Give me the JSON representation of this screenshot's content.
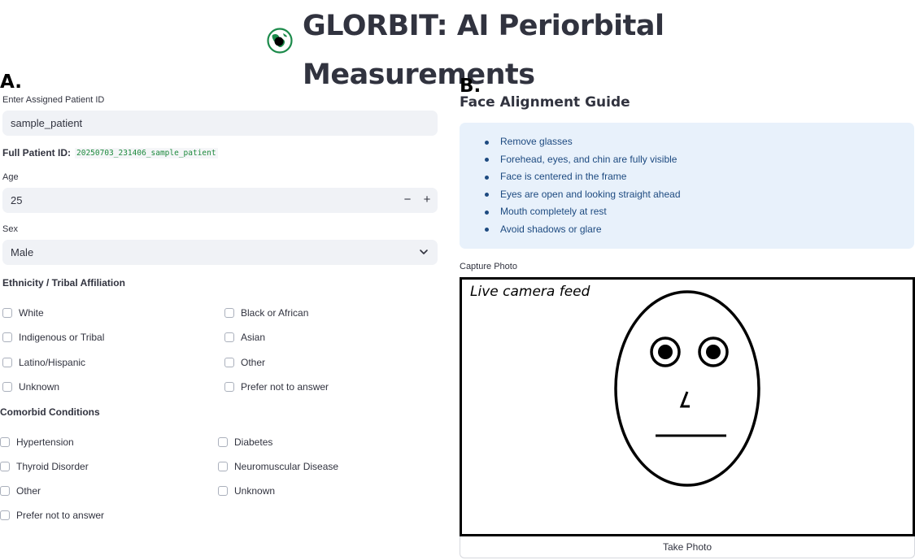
{
  "header": {
    "title_line1": "GLORBIT: AI Periorbital",
    "title_line2": "Measurements",
    "logo_icon": "globe-icon"
  },
  "panel_a": {
    "letter": "A.",
    "patient_id": {
      "label": "Enter Assigned Patient ID",
      "value": "sample_patient"
    },
    "full_id": {
      "label": "Full Patient ID:",
      "value": "20250703_231406_sample_patient"
    },
    "age": {
      "label": "Age",
      "value": "25",
      "minus": "−",
      "plus": "+"
    },
    "sex": {
      "label": "Sex",
      "value": "Male"
    },
    "ethnicity": {
      "title": "Ethnicity / Tribal Affiliation",
      "left": [
        "White",
        "Indigenous or Tribal",
        "Latino/Hispanic",
        "Unknown"
      ],
      "right": [
        "Black or African",
        "Asian",
        "Other",
        "Prefer not to answer"
      ]
    },
    "comorbid": {
      "title": "Comorbid Conditions",
      "left": [
        "Hypertension",
        "Thyroid Disorder",
        "Other",
        "Prefer not to answer"
      ],
      "right": [
        "Diabetes",
        "Neuromuscular Disease",
        "Unknown"
      ]
    }
  },
  "panel_b": {
    "letter": "B.",
    "guide_title": "Face Alignment Guide",
    "guide_items": [
      "Remove glasses",
      "Forehead, eyes, and chin are fully visible",
      "Face is centered in the frame",
      "Eyes are open and looking straight ahead",
      "Mouth completely at rest",
      "Avoid shadows or glare"
    ],
    "capture_label": "Capture Photo",
    "camera_label": "Live camera feed",
    "take_photo": "Take Photo"
  },
  "colors": {
    "input_bg": "#f0f2f6",
    "guide_bg": "#e8f1fb",
    "guide_text": "#1d4a80",
    "code_text": "#1e8a3e",
    "logo_green": "#1b8a4a"
  }
}
